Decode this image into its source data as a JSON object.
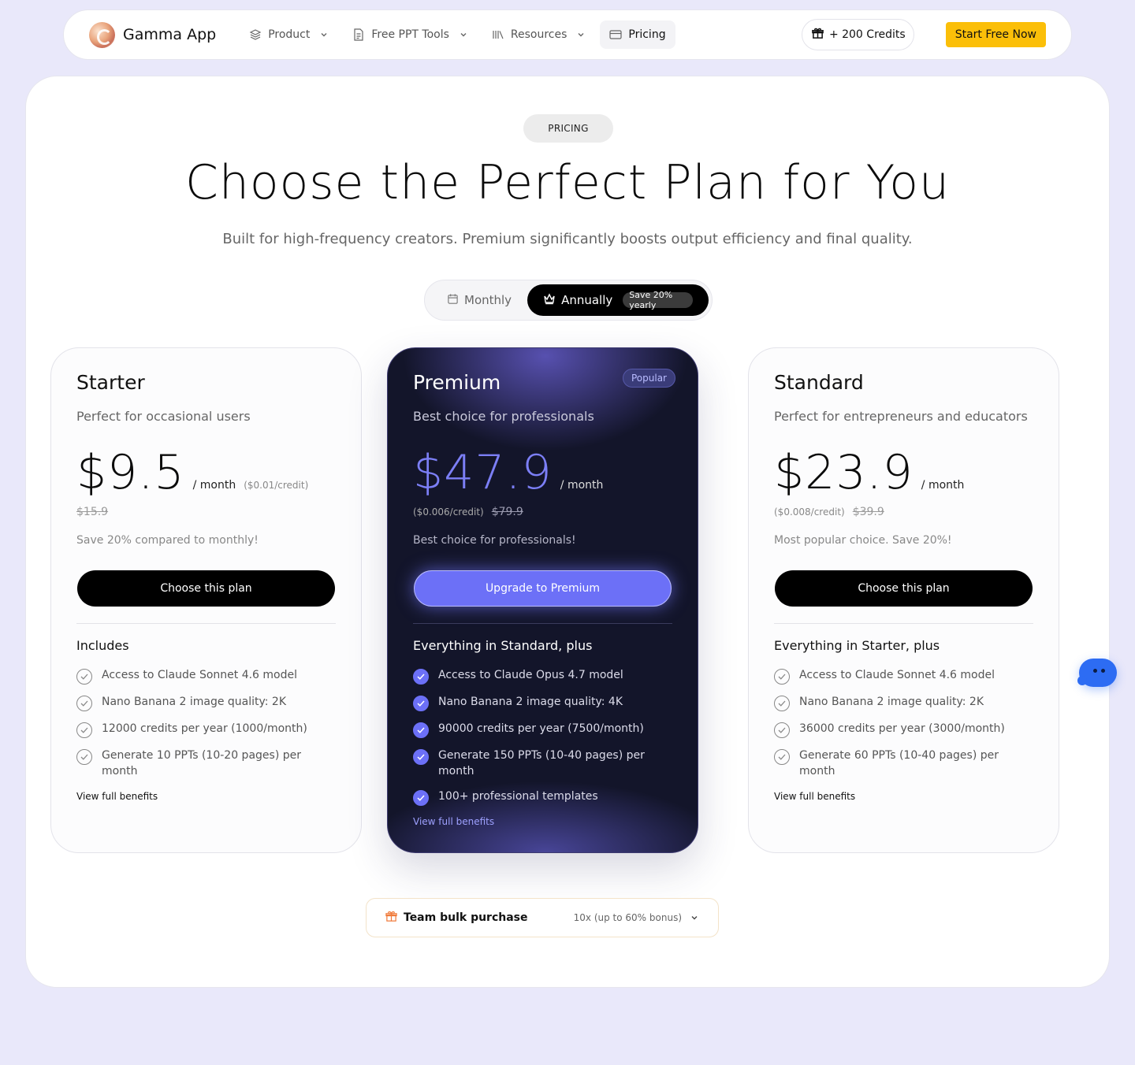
{
  "nav": {
    "brand": "Gamma App",
    "items": [
      {
        "label": "Product",
        "icon": "layers-icon",
        "dropdown": true
      },
      {
        "label": "Free PPT Tools",
        "icon": "document-icon",
        "dropdown": true
      },
      {
        "label": "Resources",
        "icon": "library-icon",
        "dropdown": true
      },
      {
        "label": "Pricing",
        "icon": "card-icon",
        "dropdown": false,
        "active": true
      }
    ],
    "credits_label": "+ 200 Credits",
    "start_label": "Start Free Now"
  },
  "hero": {
    "badge": "PRICING",
    "title": "Choose the Perfect Plan for You",
    "subtitle": "Built for high-frequency creators. Premium significantly boosts output efficiency and final quality."
  },
  "billing": {
    "monthly": "Monthly",
    "annually": "Annually",
    "save": "Save 20% yearly",
    "selected": "Annually"
  },
  "plans": [
    {
      "name": "Starter",
      "desc": "Perfect for occasional users",
      "price": "$9.5",
      "per": "/ month",
      "per_credit": "($0.01/credit)",
      "old_price": "$15.9",
      "note": "Save 20% compared to monthly!",
      "cta": "Choose this plan",
      "includes_title": "Includes",
      "features": [
        "Access to Claude Sonnet 4.6 model",
        "Nano Banana 2 image quality: 2K",
        "12000 credits per year (1000/month)",
        "Generate 10 PPTs (10-20 pages) per month"
      ],
      "view_link": "View full benefits"
    },
    {
      "name": "Premium",
      "badge": "Popular",
      "desc": "Best choice for professionals",
      "price": "$47.9",
      "per": "/ month",
      "per_credit": "($0.006/credit)",
      "old_price": "$79.9",
      "note": "Best choice for professionals!",
      "cta": "Upgrade to Premium",
      "includes_title": "Everything in Standard, plus",
      "features": [
        "Access to Claude Opus 4.7 model",
        "Nano Banana 2 image quality: 4K",
        "90000 credits per year (7500/month)",
        "Generate 150 PPTs (10-40 pages) per month",
        "100+ professional templates"
      ],
      "view_link": "View full benefits"
    },
    {
      "name": "Standard",
      "desc": "Perfect for entrepreneurs and educators",
      "price": "$23.9",
      "per": "/ month",
      "per_credit": "($0.008/credit)",
      "old_price": "$39.9",
      "note": "Most popular choice. Save 20%!",
      "cta": "Choose this plan",
      "includes_title": "Everything in Starter, plus",
      "features": [
        "Access to Claude Sonnet 4.6 model",
        "Nano Banana 2 image quality: 2K",
        "36000 credits per year (3000/month)",
        "Generate 60 PPTs (10-40 pages) per month"
      ],
      "view_link": "View full benefits"
    }
  ],
  "bulk": {
    "title": "Team bulk purchase",
    "detail": "10x (up to 60% bonus)"
  },
  "colors": {
    "page_bg": "#e9e8fa",
    "accent": "#6c70f7",
    "cta_yellow": "#fbbf09",
    "chat_blue": "#2d6cf3"
  }
}
